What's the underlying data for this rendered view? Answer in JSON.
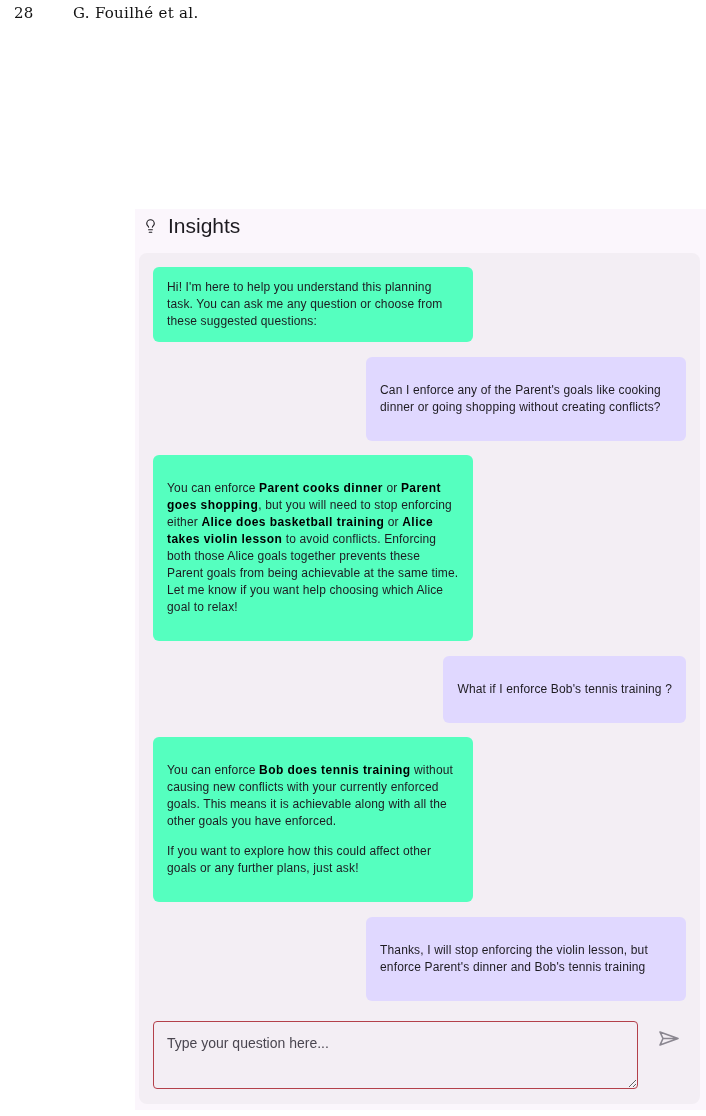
{
  "page_header": {
    "page_number": "28",
    "running_title": "G. Fouilhé et al."
  },
  "panel": {
    "title": "Insights"
  },
  "messages": [
    {
      "kind": "assistant",
      "text": "Hi! I'm here to help you understand this planning task. You can ask me any question or choose from these suggested questions:"
    },
    {
      "kind": "user",
      "paragraphs": [
        "Can I enforce any of the Parent's goals like cooking dinner or going shopping without creating conflicts?"
      ]
    },
    {
      "kind": "assistant",
      "paragraphs": [
        "You can enforce **Parent cooks dinner** or **Parent goes shopping**, but you will need to stop enforcing either **Alice does basketball training** or **Alice takes violin lesson** to avoid conflicts. Enforcing both those Alice goals together prevents these Parent goals from being achievable at the same time. Let me know if you want help choosing which Alice goal to relax!"
      ]
    },
    {
      "kind": "user",
      "paragraphs": [
        "What if I enforce Bob's tennis training ?"
      ]
    },
    {
      "kind": "assistant",
      "paragraphs": [
        "You can enforce **Bob does tennis training** without causing new conflicts with your currently enforced goals. This means it is achievable along with all the other goals you have enforced.",
        "If you want to explore how this could affect other goals or any further plans, just ask!"
      ]
    },
    {
      "kind": "user",
      "paragraphs": [
        "Thanks, I will stop enforcing the violin lesson, but enforce Parent's dinner and Bob's tennis training"
      ]
    }
  ],
  "input": {
    "placeholder": "Type your question here..."
  }
}
